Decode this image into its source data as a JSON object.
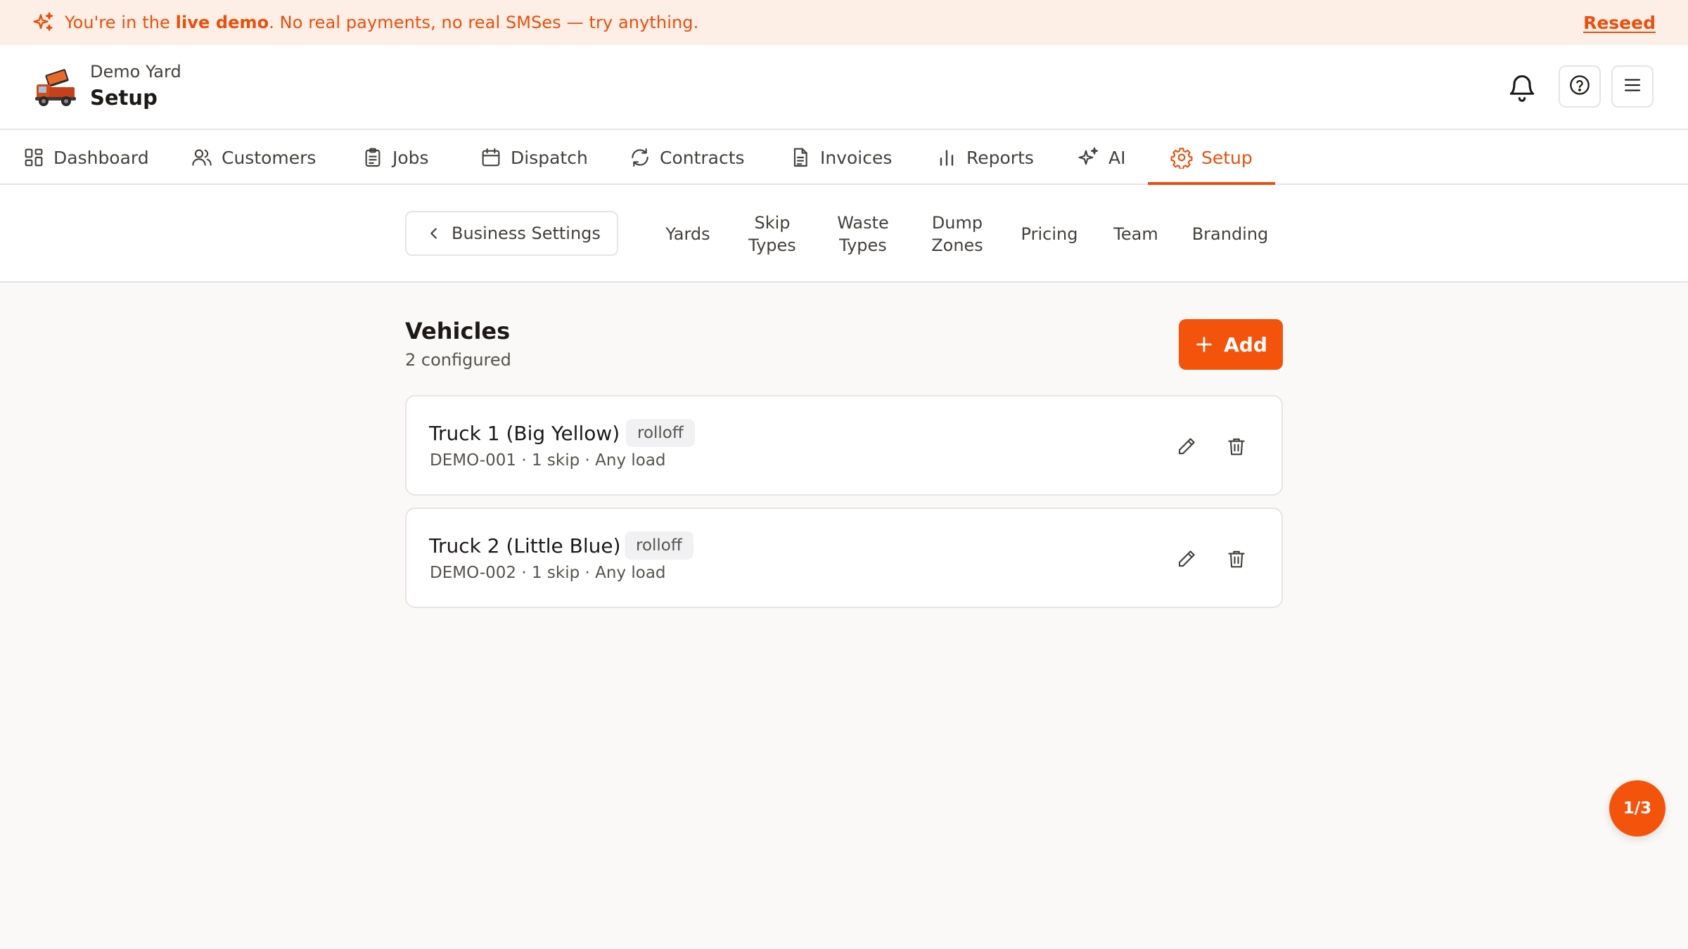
{
  "banner": {
    "prefix": "You're in the ",
    "highlight": "live demo",
    "suffix": ". No real payments, no real SMSes — try anything.",
    "action": "Reseed"
  },
  "header": {
    "yard_name": "Demo Yard",
    "page_title": "Setup"
  },
  "nav": {
    "tabs": [
      {
        "label": "Dashboard",
        "icon": "dashboard-icon"
      },
      {
        "label": "Customers",
        "icon": "users-icon"
      },
      {
        "label": "Jobs",
        "icon": "clipboard-icon"
      },
      {
        "label": "Dispatch",
        "icon": "calendar-icon"
      },
      {
        "label": "Contracts",
        "icon": "refresh-icon"
      },
      {
        "label": "Invoices",
        "icon": "document-icon"
      },
      {
        "label": "Reports",
        "icon": "bar-chart-icon"
      },
      {
        "label": "AI",
        "icon": "sparkle-icon"
      },
      {
        "label": "Setup",
        "icon": "gear-icon",
        "active": true
      }
    ]
  },
  "subnav": {
    "back_label": "Business Settings",
    "tabs": [
      {
        "line1": "Yards",
        "line2": ""
      },
      {
        "line1": "Skip",
        "line2": "Types"
      },
      {
        "line1": "Waste",
        "line2": "Types"
      },
      {
        "line1": "Dump",
        "line2": "Zones"
      },
      {
        "line1": "Pricing",
        "line2": ""
      },
      {
        "line1": "Team",
        "line2": ""
      },
      {
        "line1": "Branding",
        "line2": ""
      }
    ]
  },
  "section": {
    "title": "Vehicles",
    "subtitle": "2 configured",
    "add_label": "Add"
  },
  "vehicles": [
    {
      "name": "Truck 1 (Big Yellow)",
      "type": "rolloff",
      "details": "DEMO-001 · 1 skip · Any load"
    },
    {
      "name": "Truck 2 (Little Blue)",
      "type": "rolloff",
      "details": "DEMO-002 · 1 skip · Any load"
    }
  ],
  "pager": {
    "label": "1/3"
  },
  "colors": {
    "accent": "#f4530c",
    "banner_bg": "#fdeee6",
    "banner_text": "#e8500c",
    "page_bg": "#faf9f7",
    "border": "#e7e5e4"
  }
}
